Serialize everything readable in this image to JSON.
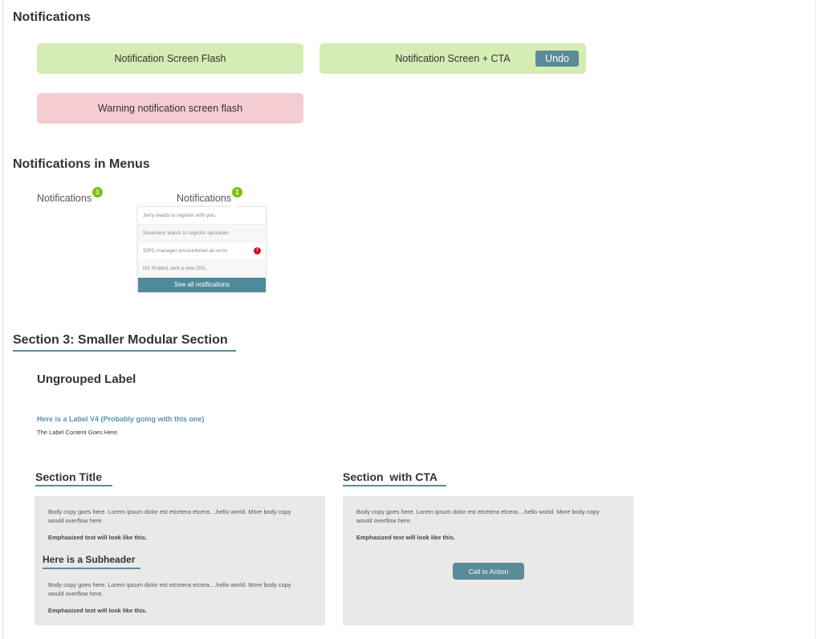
{
  "notifications": {
    "title": "Notifications",
    "flash_success": "Notification Screen Flash",
    "flash_cta": "Notification Screen + CTA",
    "undo_label": "Undo",
    "flash_warning": "Warning notification screen flash"
  },
  "menus": {
    "title": "Notifications in Menus",
    "trigger_label": "Notifications",
    "badge_count": "1",
    "items": [
      {
        "text": "Jerry wants to register with you."
      },
      {
        "text": "Sinameric wants to register upstream"
      },
      {
        "text": "SIPC manager encountered an error.",
        "error_badge": "!"
      },
      {
        "text": "NX Protect sent a new DSL"
      }
    ],
    "see_all": "See all notifications"
  },
  "section3": {
    "title": "Section 3: Smaller Modular Section",
    "ungrouped_label": "Ungrouped Label",
    "label_v4_title": "Here is a Label V4 (Probably going with this one)",
    "label_v4_content": "The Label Content Goes Here."
  },
  "section_title_panel": {
    "title": "Section Title",
    "body1": "Body copy goes here. Lorem ipsum dolor est etcetera etcera....hello world. More body copy would overflow here.",
    "emph1": "Emphasized text will look like this.",
    "subheader": "Here is a Subheader",
    "body2": "Body copy goes here. Lorem ipsum dolor est etcetera etcera....hello world. More body copy would overflow here.",
    "emph2": "Emphasized text will look like this."
  },
  "section_cta_panel": {
    "title": "Section  with CTA",
    "body": "Body copy goes here. Lorem ipsum dolor est etcetera etcera....hello world. More body copy would overflow here.",
    "emph": "Emphasized text will look like this.",
    "cta_label": "Call to Action"
  },
  "colors": {
    "success_bg": "#d5ecb5",
    "warning_bg": "#f5ccd1",
    "accent_teal": "#5b8a98",
    "badge_green": "#7ac20e",
    "error_red": "#d0112b",
    "panel_bg": "#e9e9e9"
  }
}
